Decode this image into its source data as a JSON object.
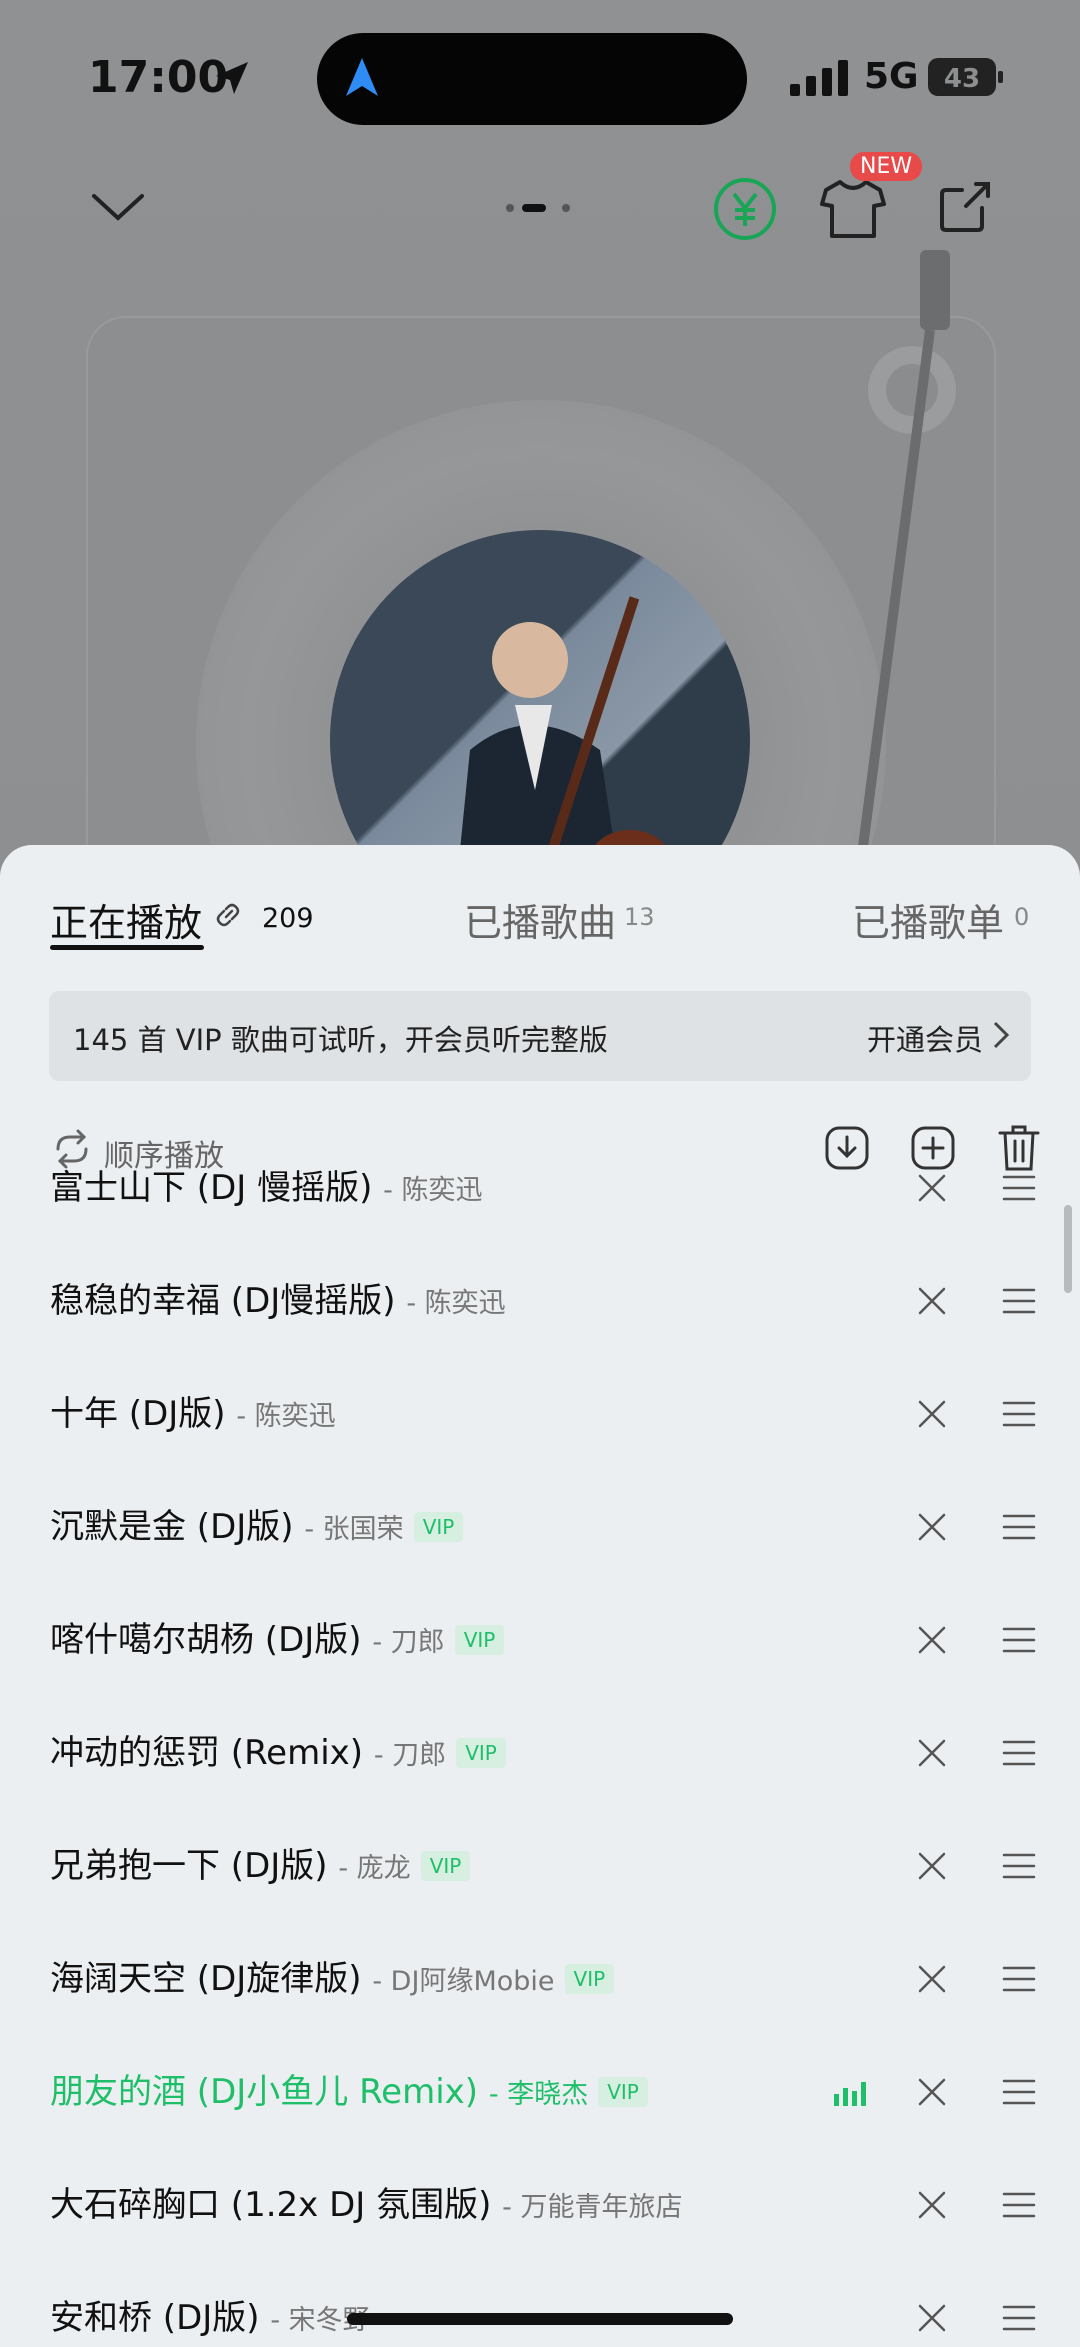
{
  "status_bar": {
    "time": "17:00",
    "network": "5G",
    "battery": "43"
  },
  "header": {
    "new_badge": "NEW"
  },
  "sheet": {
    "tabs": {
      "now_playing": "正在播放",
      "now_playing_count": "209",
      "played_songs": "已播歌曲",
      "played_songs_count": "13",
      "played_playlists": "已播歌单",
      "played_playlists_count": "0"
    },
    "vip_banner": {
      "text": "145 首 VIP 歌曲可试听，开会员听完整版",
      "cta": "开通会员"
    },
    "toolbar": {
      "mode": "顺序播放"
    },
    "songs": [
      {
        "title": "富士山下 (DJ 慢摇版)",
        "artist": "- 陈奕迅",
        "vip": ""
      },
      {
        "title": "稳稳的幸福 (DJ慢摇版)",
        "artist": "- 陈奕迅",
        "vip": ""
      },
      {
        "title": "十年 (DJ版)",
        "artist": "- 陈奕迅",
        "vip": ""
      },
      {
        "title": "沉默是金 (DJ版)",
        "artist": "- 张国荣",
        "vip": "VIP"
      },
      {
        "title": "喀什噶尔胡杨 (DJ版)",
        "artist": "- 刀郎",
        "vip": "VIP"
      },
      {
        "title": "冲动的惩罚 (Remix)",
        "artist": "- 刀郎",
        "vip": "VIP"
      },
      {
        "title": "兄弟抱一下 (DJ版)",
        "artist": "- 庞龙",
        "vip": "VIP"
      },
      {
        "title": "海阔天空 (DJ旋律版)",
        "artist": "- DJ阿缘Mobie",
        "vip": "VIP"
      },
      {
        "title": "朋友的酒 (DJ小鱼儿 Remix)",
        "artist": "- 李晓杰",
        "vip": "VIP",
        "playing": true
      },
      {
        "title": "大石碎胸口 (1.2x DJ 氛围版)",
        "artist": "- 万能青年旅店",
        "vip": ""
      },
      {
        "title": "安和桥 (DJ版)",
        "artist": "- 宋冬野",
        "vip": ""
      }
    ]
  },
  "colors": {
    "accent": "#1fbf6a",
    "sheet_bg": "#eceff1",
    "overlay": "#8c8e90"
  }
}
